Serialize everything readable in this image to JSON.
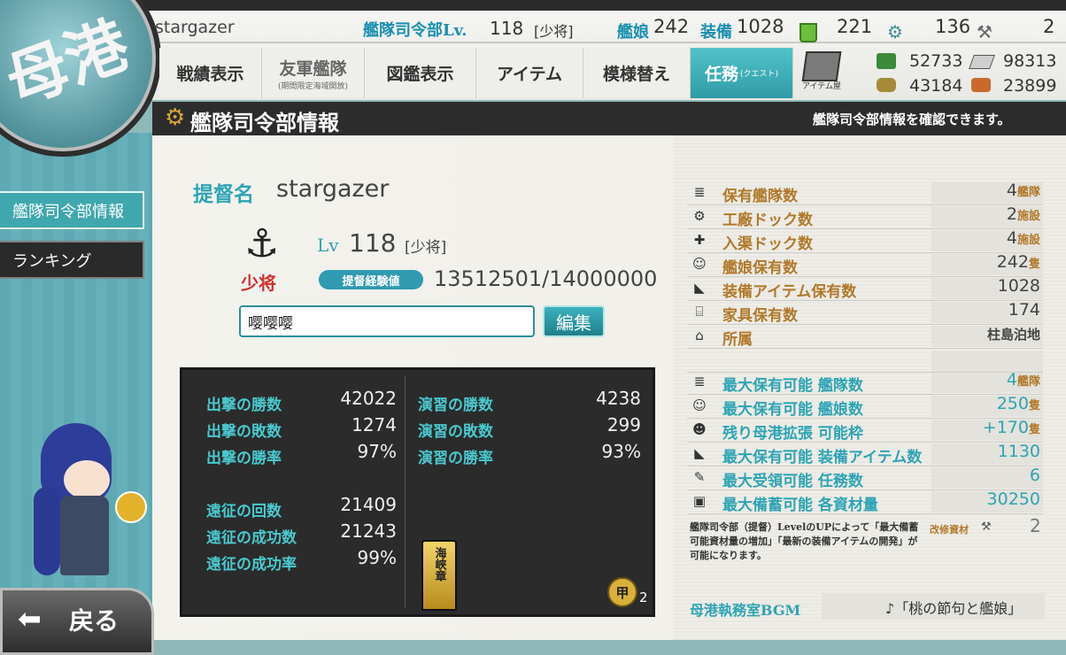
{
  "header": {
    "admiral_name": "stargazer",
    "hq_label": "艦隊司令部Lv.",
    "hq_level": "118",
    "hq_rank": "[少将]",
    "ship_label": "艦娘",
    "ship_count": "242",
    "equip_label": "装備",
    "equip_count": "1028",
    "bucket_count": "221",
    "devmat_count": "136",
    "screw_count": "2"
  },
  "tabs": [
    {
      "label": "戦績表示",
      "sub": ""
    },
    {
      "label": "友軍艦隊",
      "sub": "(期間限定海域開放)"
    },
    {
      "label": "図鑑表示",
      "sub": ""
    },
    {
      "label": "アイテム",
      "sub": ""
    },
    {
      "label": "模様替え",
      "sub": ""
    },
    {
      "label": "任務",
      "sub": "(クエスト)"
    }
  ],
  "shop_label": "アイテム屋",
  "resources": {
    "fuel": "52733",
    "ammo": "43184",
    "steel": "98313",
    "bauxite": "23899"
  },
  "page_title": "艦隊司令部情報",
  "page_desc": "艦隊司令部情報を確認できます。",
  "sidebar": {
    "items": [
      {
        "label": "艦隊司令部情報"
      },
      {
        "label": "ランキング"
      }
    ],
    "back_label": "戻る"
  },
  "profile": {
    "admiral_label": "提督名",
    "admiral_name": "stargazer",
    "rank_emblem": "少将",
    "lv_label": "Lv",
    "level": "118",
    "rank": "[少将]",
    "exp_label": "提督経験値",
    "exp_value": "13512501/14000000",
    "comment": "嘤嘤嘤",
    "edit_label": "編集"
  },
  "battle_stats": {
    "sortie_wins_label": "出撃の勝数",
    "sortie_wins": "42022",
    "sortie_losses_label": "出撃の敗数",
    "sortie_losses": "1274",
    "sortie_rate_label": "出撃の勝率",
    "sortie_rate": "97%",
    "exercise_wins_label": "演習の勝数",
    "exercise_wins": "4238",
    "exercise_losses_label": "演習の敗数",
    "exercise_losses": "299",
    "exercise_rate_label": "演習の勝率",
    "exercise_rate": "93%",
    "expedition_count_label": "遠征の回数",
    "expedition_count": "21409",
    "expedition_success_label": "遠征の成功数",
    "expedition_success": "21243",
    "expedition_rate_label": "遠征の成功率",
    "expedition_rate": "99%",
    "medal_text": "海峡章",
    "kou_medal": "甲",
    "kou_count": "2"
  },
  "hq_info": [
    {
      "icon": "fleet-icon",
      "label": "保有艦隊数",
      "value": "4",
      "unit": "艦隊"
    },
    {
      "icon": "gear-icon",
      "label": "工廠ドック数",
      "value": "2",
      "unit": "施設"
    },
    {
      "icon": "repair-icon",
      "label": "入渠ドック数",
      "value": "4",
      "unit": "施設"
    },
    {
      "icon": "shipgirl-icon",
      "label": "艦娘保有数",
      "value": "242",
      "unit": "隻"
    },
    {
      "icon": "equipment-icon",
      "label": "装備アイテム保有数",
      "value": "1028",
      "unit": ""
    },
    {
      "icon": "furniture-icon",
      "label": "家具保有数",
      "value": "174",
      "unit": ""
    },
    {
      "icon": "base-icon",
      "label": "所属",
      "value": "柱島泊地",
      "unit": ""
    }
  ],
  "hq_limits": [
    {
      "icon": "fleet-icon",
      "label": "最大保有可能 艦隊数",
      "value": "4",
      "unit": "艦隊"
    },
    {
      "icon": "shipgirl-icon",
      "label": "最大保有可能 艦娘数",
      "value": "250",
      "unit": "隻"
    },
    {
      "icon": "port-expand-icon",
      "label": "残り母港拡張 可能枠",
      "value": "+170",
      "unit": "隻"
    },
    {
      "icon": "equipment-icon",
      "label": "最大保有可能 装備アイテム数",
      "value": "1130",
      "unit": ""
    },
    {
      "icon": "quest-icon",
      "label": "最大受領可能 任務数",
      "value": "6",
      "unit": ""
    },
    {
      "icon": "storage-icon",
      "label": "最大備蓄可能 各資材量",
      "value": "30250",
      "unit": ""
    }
  ],
  "hq_note": "艦隊司令部（提督）LevelのUPによって「最大備蓄可能資材量の増加」「最新の装備アイテムの開発」が可能になります。",
  "improve_label": "改修資材",
  "improve_count": "2",
  "bgm_label": "母港執務室BGM",
  "bgm_value": "♪「桃の節句と艦娘」",
  "colors": {
    "accent": "#2ea4b4",
    "gold": "#b0792a",
    "dark": "#2b2b2b"
  }
}
